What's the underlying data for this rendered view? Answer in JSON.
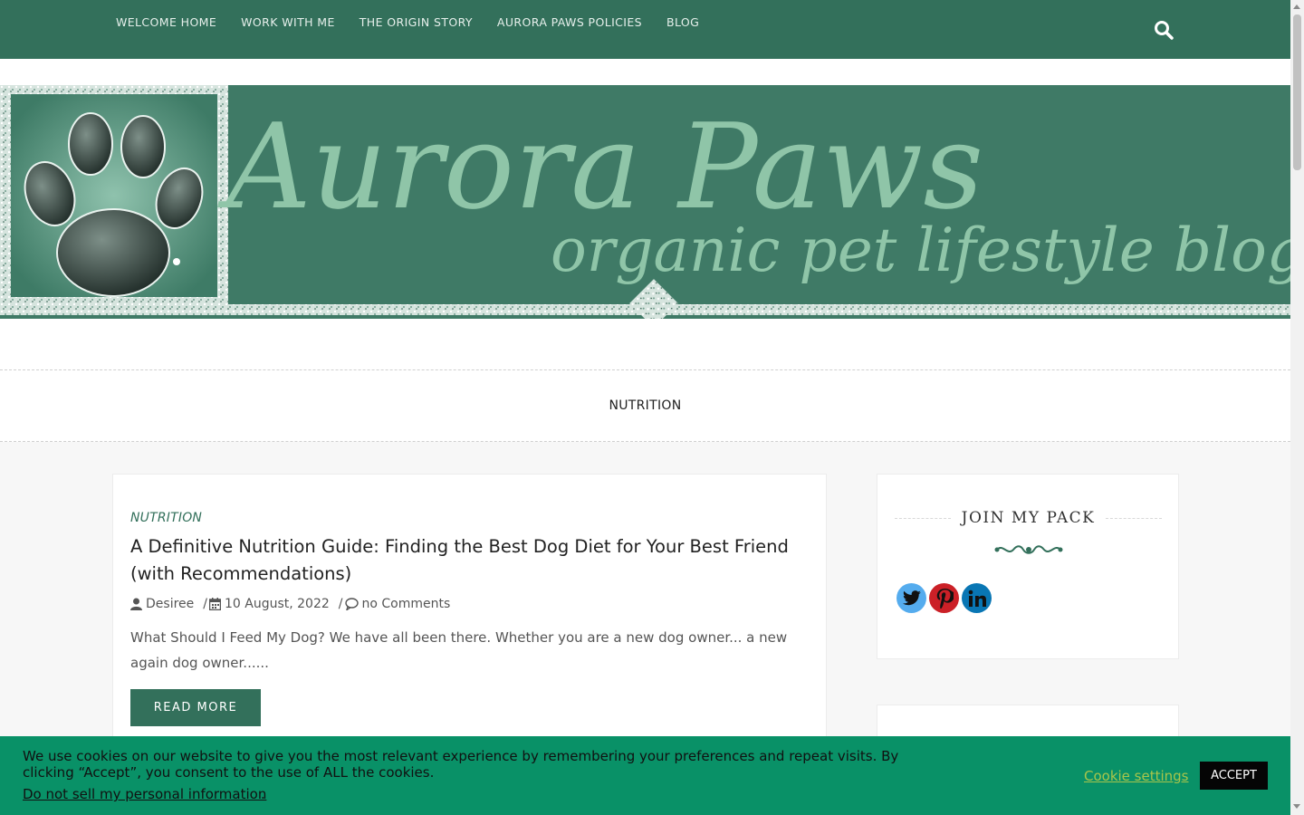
{
  "nav": {
    "items": [
      {
        "label": "WELCOME HOME"
      },
      {
        "label": "WORK WITH ME"
      },
      {
        "label": "THE ORIGIN STORY"
      },
      {
        "label": "AURORA PAWS POLICIES"
      },
      {
        "label": "BLOG"
      }
    ],
    "search_icon": "search-icon"
  },
  "banner": {
    "title": "Aurora Paws",
    "subtitle": "organic pet lifestyle blog"
  },
  "category_page": {
    "title": "NUTRITION"
  },
  "post": {
    "category": "NUTRITION",
    "title": "A Definitive Nutrition Guide: Finding the Best Dog Diet for Your Best Friend (with Recommendations)",
    "author": "Desiree",
    "date": "10 August, 2022",
    "comments": "no Comments",
    "excerpt": "What Should I Feed My Dog? We have all been there. Whether you are a new dog owner... a new again dog owner......",
    "read_more": "READ MORE"
  },
  "sidebar": {
    "widget_title": "JOIN MY PACK",
    "social": [
      {
        "icon": "twitter-icon",
        "color": "#55acee"
      },
      {
        "icon": "pinterest-icon",
        "color": "#cb2027"
      },
      {
        "icon": "linkedin-icon",
        "color": "#0976b4"
      }
    ]
  },
  "cookie": {
    "text": "We use cookies on our website to give you the most relevant experience by remembering your preferences and repeat visits. By clicking “Accept”, you consent to the use of ALL the cookies.",
    "link": "Do not sell my personal information",
    "settings": "Cookie settings",
    "accept": "ACCEPT"
  },
  "colors": {
    "brand": "#33705b",
    "cookie_bg": "#099167"
  }
}
